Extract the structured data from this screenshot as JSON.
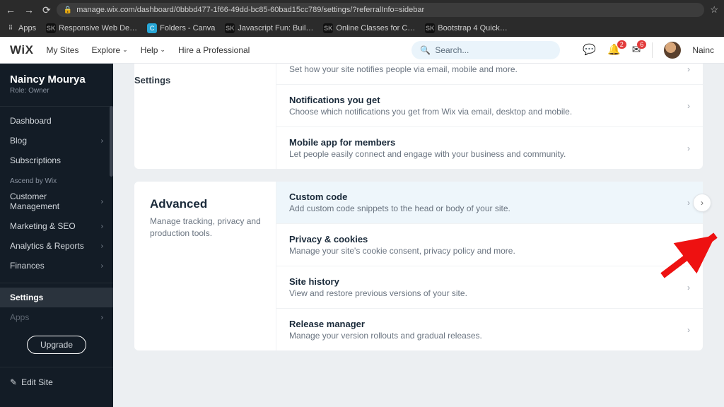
{
  "browser": {
    "url": "manage.wix.com/dashboard/0bbbd477-1f66-49dd-bc85-60bad15cc789/settings/?referralInfo=sidebar",
    "bookmarks": [
      {
        "label": "Apps",
        "fav": "apps"
      },
      {
        "label": "Responsive Web De…",
        "fav": "sk"
      },
      {
        "label": "Folders - Canva",
        "fav": "c"
      },
      {
        "label": "Javascript Fun: Buil…",
        "fav": "sk"
      },
      {
        "label": "Online Classes for C…",
        "fav": "sk"
      },
      {
        "label": "Bootstrap 4 Quick…",
        "fav": "sk"
      }
    ]
  },
  "topnav": {
    "logo": "WiX",
    "items": [
      {
        "label": "My Sites",
        "dd": false
      },
      {
        "label": "Explore",
        "dd": true
      },
      {
        "label": "Help",
        "dd": true
      },
      {
        "label": "Hire a Professional",
        "dd": false
      }
    ],
    "search_placeholder": "Search...",
    "badges": {
      "bell": "2",
      "inbox": "6"
    },
    "username": "Nainc"
  },
  "sidebar": {
    "site_name": "Naincy Mourya",
    "role": "Role: Owner",
    "items_a": [
      {
        "label": "Dashboard",
        "chev": false
      },
      {
        "label": "Blog",
        "chev": true
      },
      {
        "label": "Subscriptions",
        "chev": false
      }
    ],
    "section_label": "Ascend by Wix",
    "items_b": [
      {
        "label": "Customer Management",
        "chev": true
      },
      {
        "label": "Marketing & SEO",
        "chev": true
      },
      {
        "label": "Analytics & Reports",
        "chev": true
      },
      {
        "label": "Finances",
        "chev": true
      }
    ],
    "settings": "Settings",
    "apps": "Apps",
    "upgrade": "Upgrade",
    "edit_site": "Edit Site"
  },
  "page": {
    "crumb": "Settings",
    "prev_panel_rows": [
      {
        "title": "",
        "desc": "Set how your site notifies people via email, mobile and more."
      },
      {
        "title": "Notifications you get",
        "desc": "Choose which notifications you get from Wix via email, desktop and mobile."
      },
      {
        "title": "Mobile app for members",
        "desc": "Let people easily connect and engage with your business and community."
      }
    ],
    "advanced": {
      "title": "Advanced",
      "desc": "Manage tracking, privacy and production tools.",
      "rows": [
        {
          "title": "Custom code",
          "desc": "Add custom code snippets to the head or body of your site.",
          "highlight": true
        },
        {
          "title": "Privacy & cookies",
          "desc": "Manage your site's cookie consent, privacy policy and more."
        },
        {
          "title": "Site history",
          "desc": "View and restore previous versions of your site."
        },
        {
          "title": "Release manager",
          "desc": "Manage your version rollouts and gradual releases."
        }
      ]
    }
  }
}
